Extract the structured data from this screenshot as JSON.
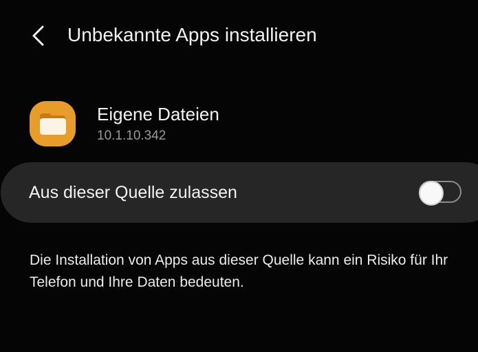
{
  "header": {
    "back_icon": "chevron-left-icon",
    "title": "Unbekannte Apps installieren"
  },
  "app": {
    "icon": "folder-icon",
    "icon_color": "#e89d2b",
    "name": "Eigene Dateien",
    "version": "10.1.10.342"
  },
  "setting": {
    "label": "Aus dieser Quelle zulassen",
    "enabled": false
  },
  "description": "Die Installation von Apps aus dieser Quelle kann ein Risiko für Ihr Telefon und Ihre Daten bedeuten.",
  "colors": {
    "background": "#050505",
    "row_background": "#262626",
    "secondary_text": "#9a9a9a"
  }
}
